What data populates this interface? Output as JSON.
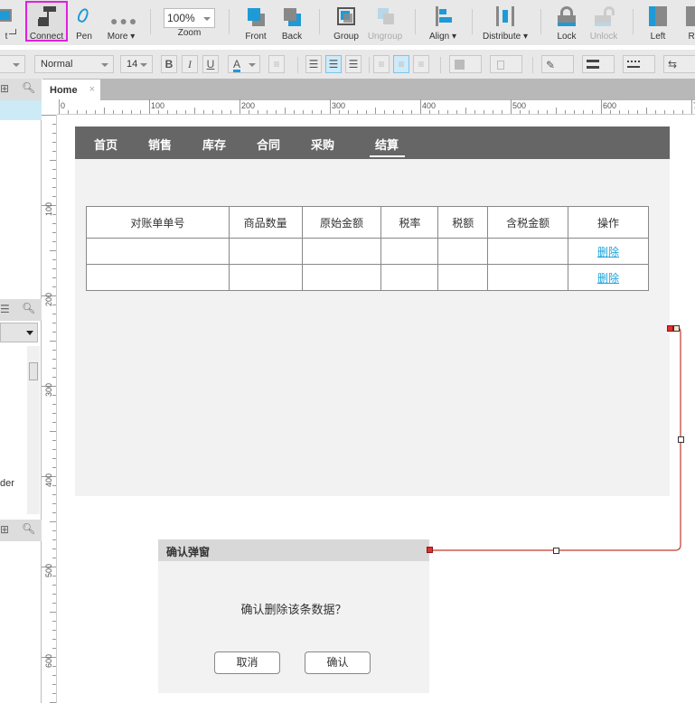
{
  "toolbar": {
    "items": [
      {
        "label": "t",
        "icon": "select-icon"
      },
      {
        "label": "Connect",
        "icon": "connect-icon",
        "highlighted": true
      },
      {
        "label": "Pen",
        "icon": "pen-icon"
      },
      {
        "label": "More ▾",
        "icon": "more-icon"
      },
      {
        "label": "Zoom",
        "icon": "zoom-select"
      },
      {
        "label": "Front",
        "icon": "bring-front-icon"
      },
      {
        "label": "Back",
        "icon": "send-back-icon"
      },
      {
        "label": "Group",
        "icon": "group-icon"
      },
      {
        "label": "Ungroup",
        "icon": "ungroup-icon",
        "disabled": true
      },
      {
        "label": "Align ▾",
        "icon": "align-icon"
      },
      {
        "label": "Distribute ▾",
        "icon": "distribute-icon"
      },
      {
        "label": "Lock",
        "icon": "lock-icon"
      },
      {
        "label": "Unlock",
        "icon": "unlock-icon",
        "disabled": true
      },
      {
        "label": "Left",
        "icon": "left-pane-icon"
      },
      {
        "label": "Rig",
        "icon": "right-pane-icon"
      }
    ],
    "zoom_value": "100%",
    "highlight_color": "#e020e0",
    "accent_color": "#1e9ad6"
  },
  "formatbar": {
    "style_value": "Normal",
    "font_size": "14",
    "bold": "B",
    "italic": "I",
    "underline": "U",
    "font_color_letter": "A"
  },
  "tabs": {
    "active": "Home",
    "close": "×"
  },
  "rulers": {
    "horizontal": [
      "0",
      "100",
      "200",
      "300",
      "400",
      "500",
      "600",
      "7"
    ],
    "vertical": [
      "100",
      "200",
      "300",
      "400",
      "500",
      "600"
    ]
  },
  "leftpanel": {
    "partial_text": "der"
  },
  "page": {
    "nav": [
      {
        "label": "首页"
      },
      {
        "label": "销售"
      },
      {
        "label": "库存"
      },
      {
        "label": "合同"
      },
      {
        "label": "采购"
      },
      {
        "label": "结算",
        "active": true
      }
    ],
    "table": {
      "headers": [
        "对账单单号",
        "商品数量",
        "原始金额",
        "税率",
        "税额",
        "含税金额",
        "操作"
      ],
      "rows": [
        [
          "",
          "",
          "",
          "",
          "",
          "",
          "删除"
        ],
        [
          "",
          "",
          "",
          "",
          "",
          "",
          "删除"
        ]
      ],
      "link_color": "#1aa3db"
    }
  },
  "dialog": {
    "title": "确认弹窗",
    "message": "确认删除该条数据？",
    "cancel": "取消",
    "confirm": "确认"
  },
  "connector": {
    "color": "#c0392b"
  }
}
